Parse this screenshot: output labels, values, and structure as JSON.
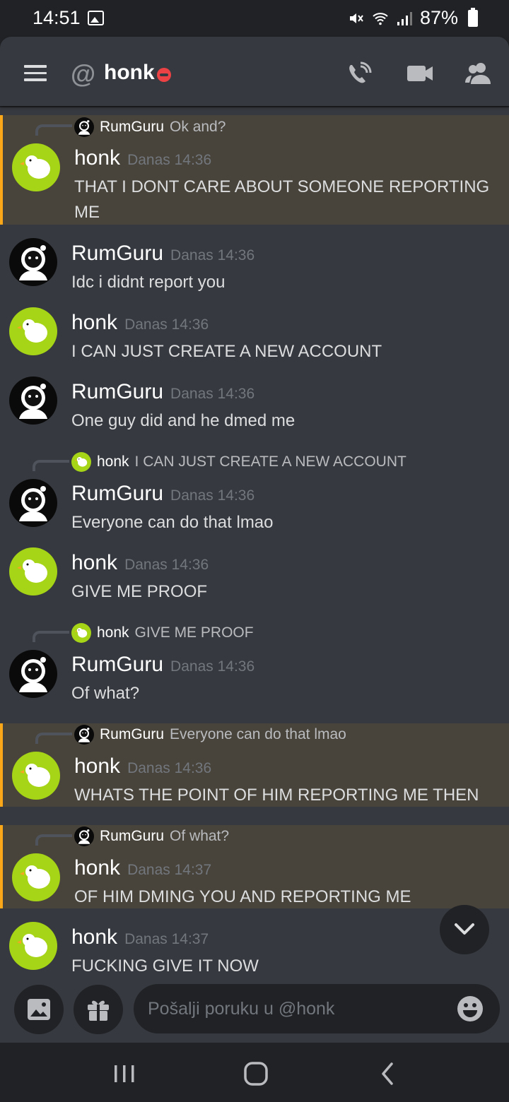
{
  "status_bar": {
    "time": "14:51",
    "battery": "87%"
  },
  "header": {
    "title": "honk"
  },
  "messages": [
    {
      "reply_to": {
        "author": "RumGuru",
        "text": "Ok and?"
      },
      "author": "honk",
      "timestamp": "Danas 14:36",
      "text": "THAT I DONT CARE ABOUT SOMEONE REPORTING ME"
    },
    {
      "author": "RumGuru",
      "timestamp": "Danas 14:36",
      "text": "Idc i didnt report you"
    },
    {
      "author": "honk",
      "timestamp": "Danas 14:36",
      "text": "I CAN JUST CREATE A NEW ACCOUNT"
    },
    {
      "author": "RumGuru",
      "timestamp": "Danas 14:36",
      "text": "One guy did and he dmed me"
    },
    {
      "reply_to": {
        "author": "honk",
        "text": "I CAN JUST CREATE A NEW ACCOUNT"
      },
      "author": "RumGuru",
      "timestamp": "Danas 14:36",
      "text": "Everyone can do that lmao"
    },
    {
      "author": "honk",
      "timestamp": "Danas 14:36",
      "text": "GIVE ME PROOF"
    },
    {
      "reply_to": {
        "author": "honk",
        "text": "GIVE ME PROOF"
      },
      "author": "RumGuru",
      "timestamp": "Danas 14:36",
      "text": "Of what?"
    },
    {
      "reply_to": {
        "author": "RumGuru",
        "text": "Everyone can do that lmao"
      },
      "author": "honk",
      "timestamp": "Danas 14:36",
      "text": "WHATS THE POINT OF HIM REPORTING ME THEN"
    },
    {
      "reply_to": {
        "author": "RumGuru",
        "text": "Of what?"
      },
      "author": "honk",
      "timestamp": "Danas 14:37",
      "text": "OF HIM DMING YOU AND REPORTING ME"
    },
    {
      "author": "honk",
      "timestamp": "Danas 14:37",
      "text": "FUCKING GIVE IT NOW"
    }
  ],
  "composer": {
    "placeholder": "Pošalji poruku u @honk"
  },
  "colors": {
    "background": "#36393f",
    "highlight": "#48443b",
    "mention_bar": "#faa81a",
    "dnd": "#ed4245",
    "honk_avatar": "#a6d416"
  }
}
